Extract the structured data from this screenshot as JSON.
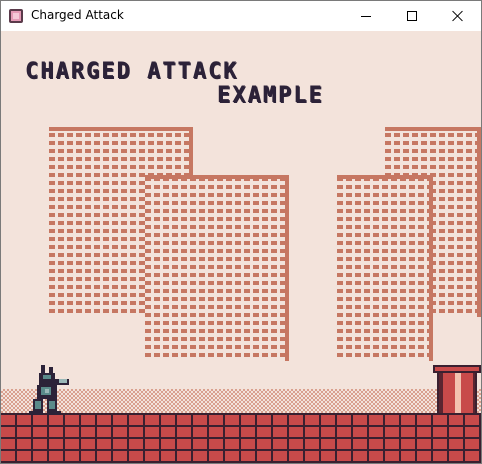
{
  "window": {
    "title": "Charged Attack",
    "icon": "app-icon",
    "controls": [
      "minimize-icon",
      "maximize-icon",
      "close-icon"
    ]
  },
  "game": {
    "headline_line1": "CHARGED ATTACK",
    "headline_line2": "EXAMPLE",
    "colors": {
      "background": "#f3e3db",
      "text": "#2c2238",
      "building": "#c67762",
      "brick": "#c84a4a",
      "brick_dark": "#3a2030"
    }
  }
}
